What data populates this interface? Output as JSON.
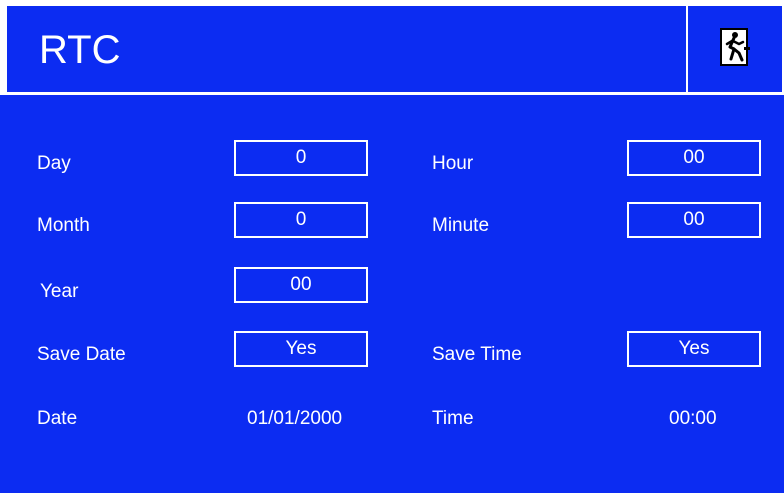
{
  "header": {
    "title": "RTC",
    "exit_icon": "exit-running-man-icon"
  },
  "fields": {
    "day": {
      "label": "Day",
      "value": "0"
    },
    "month": {
      "label": "Month",
      "value": "0"
    },
    "year": {
      "label": "Year",
      "value": "00"
    },
    "save_date": {
      "label": "Save Date",
      "value": "Yes"
    },
    "hour": {
      "label": "Hour",
      "value": "00"
    },
    "minute": {
      "label": "Minute",
      "value": "00"
    },
    "save_time": {
      "label": "Save Time",
      "value": "Yes"
    }
  },
  "readouts": {
    "date": {
      "label": "Date",
      "value": "01/01/2000"
    },
    "time": {
      "label": "Time",
      "value": "00:00"
    }
  },
  "colors": {
    "background": "#0c2cf2",
    "foreground": "#ffffff"
  }
}
